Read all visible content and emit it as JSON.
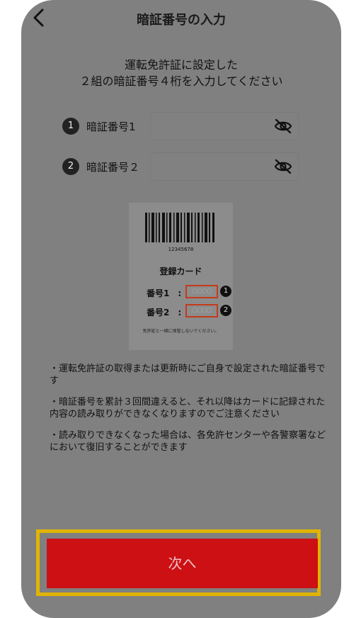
{
  "header": {
    "title": "暗証番号の入力",
    "back_icon": "chevron-left-icon"
  },
  "instruction": {
    "line1": "運転免許証に設定した",
    "line2": "２組の暗証番号４桁を入力してください"
  },
  "pin_fields": [
    {
      "number": "1",
      "label": "暗証番号1",
      "value": "",
      "icon": "eye-slash-icon"
    },
    {
      "number": "2",
      "label": "暗証番号２",
      "value": "",
      "icon": "eye-slash-icon"
    }
  ],
  "card": {
    "barcode_number": "12345678",
    "title": "登録カード",
    "rows": [
      {
        "label": "番号1　:",
        "digits": "○○○○",
        "number": "1"
      },
      {
        "label": "番号2　:",
        "digits": "○○○○",
        "number": "2"
      }
    ],
    "note": "免許証と一緒に保管しないでください。"
  },
  "notes": [
    "・運転免許証の取得または更新時にご自身で設定された暗証番号です",
    "・暗証番号を累計３回間違えると、それ以降はカードに記録された内容の読み取りができなくなりますのでご注意ください",
    "・読み取りできなくなった場合は、各免許センターや各警察署などにおいて復旧することができます"
  ],
  "next_button": {
    "label": "次へ"
  },
  "colors": {
    "primary": "#cc1014",
    "highlight": "#e0b400",
    "overlay": "#808080"
  }
}
